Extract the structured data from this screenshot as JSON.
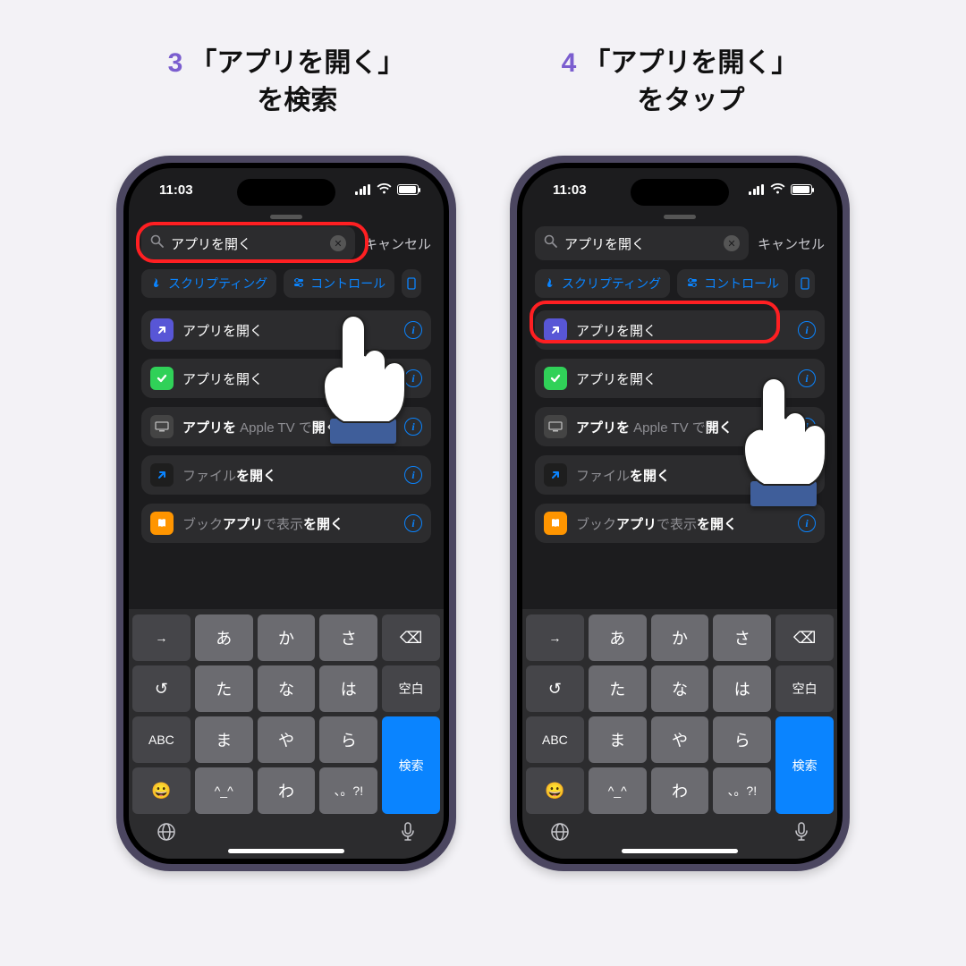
{
  "status": {
    "time": "11:03"
  },
  "search": {
    "query": "アプリを開く",
    "cancel": "キャンセル"
  },
  "chips": {
    "scripting": "スクリプティング",
    "control": "コントロール"
  },
  "rows": {
    "r1": "アプリを開く",
    "r2": "アプリを開く",
    "r3_pre": "アプリを ",
    "r3_dim": "Apple TV で",
    "r3_post": "開く",
    "r4_dim": "ファイル",
    "r4_post": "を開く",
    "r5_dim": "ブック",
    "r5_mid": "アプリ",
    "r5_dim2": "で表示",
    "r5_post": "を開く"
  },
  "kb": {
    "arrow": "→",
    "a": "あ",
    "ka": "か",
    "sa": "さ",
    "del": "⌫",
    "undo": "↺",
    "ta": "た",
    "na": "な",
    "ha": "は",
    "space": "空白",
    "abc": "ABC",
    "ma": "ま",
    "ya": "や",
    "ra": "ら",
    "search": "検索",
    "emo": "😀",
    "kao": "^_^",
    "wa": "わ",
    "punct": "、。?!"
  },
  "acc": {
    "globe": "🌐",
    "mic": "🎤"
  },
  "caption3": {
    "num": "3",
    "l1": "「アプリを開く」",
    "l2": "を検索"
  },
  "caption4": {
    "num": "4",
    "l1": "「アプリを開く」",
    "l2": "をタップ"
  }
}
